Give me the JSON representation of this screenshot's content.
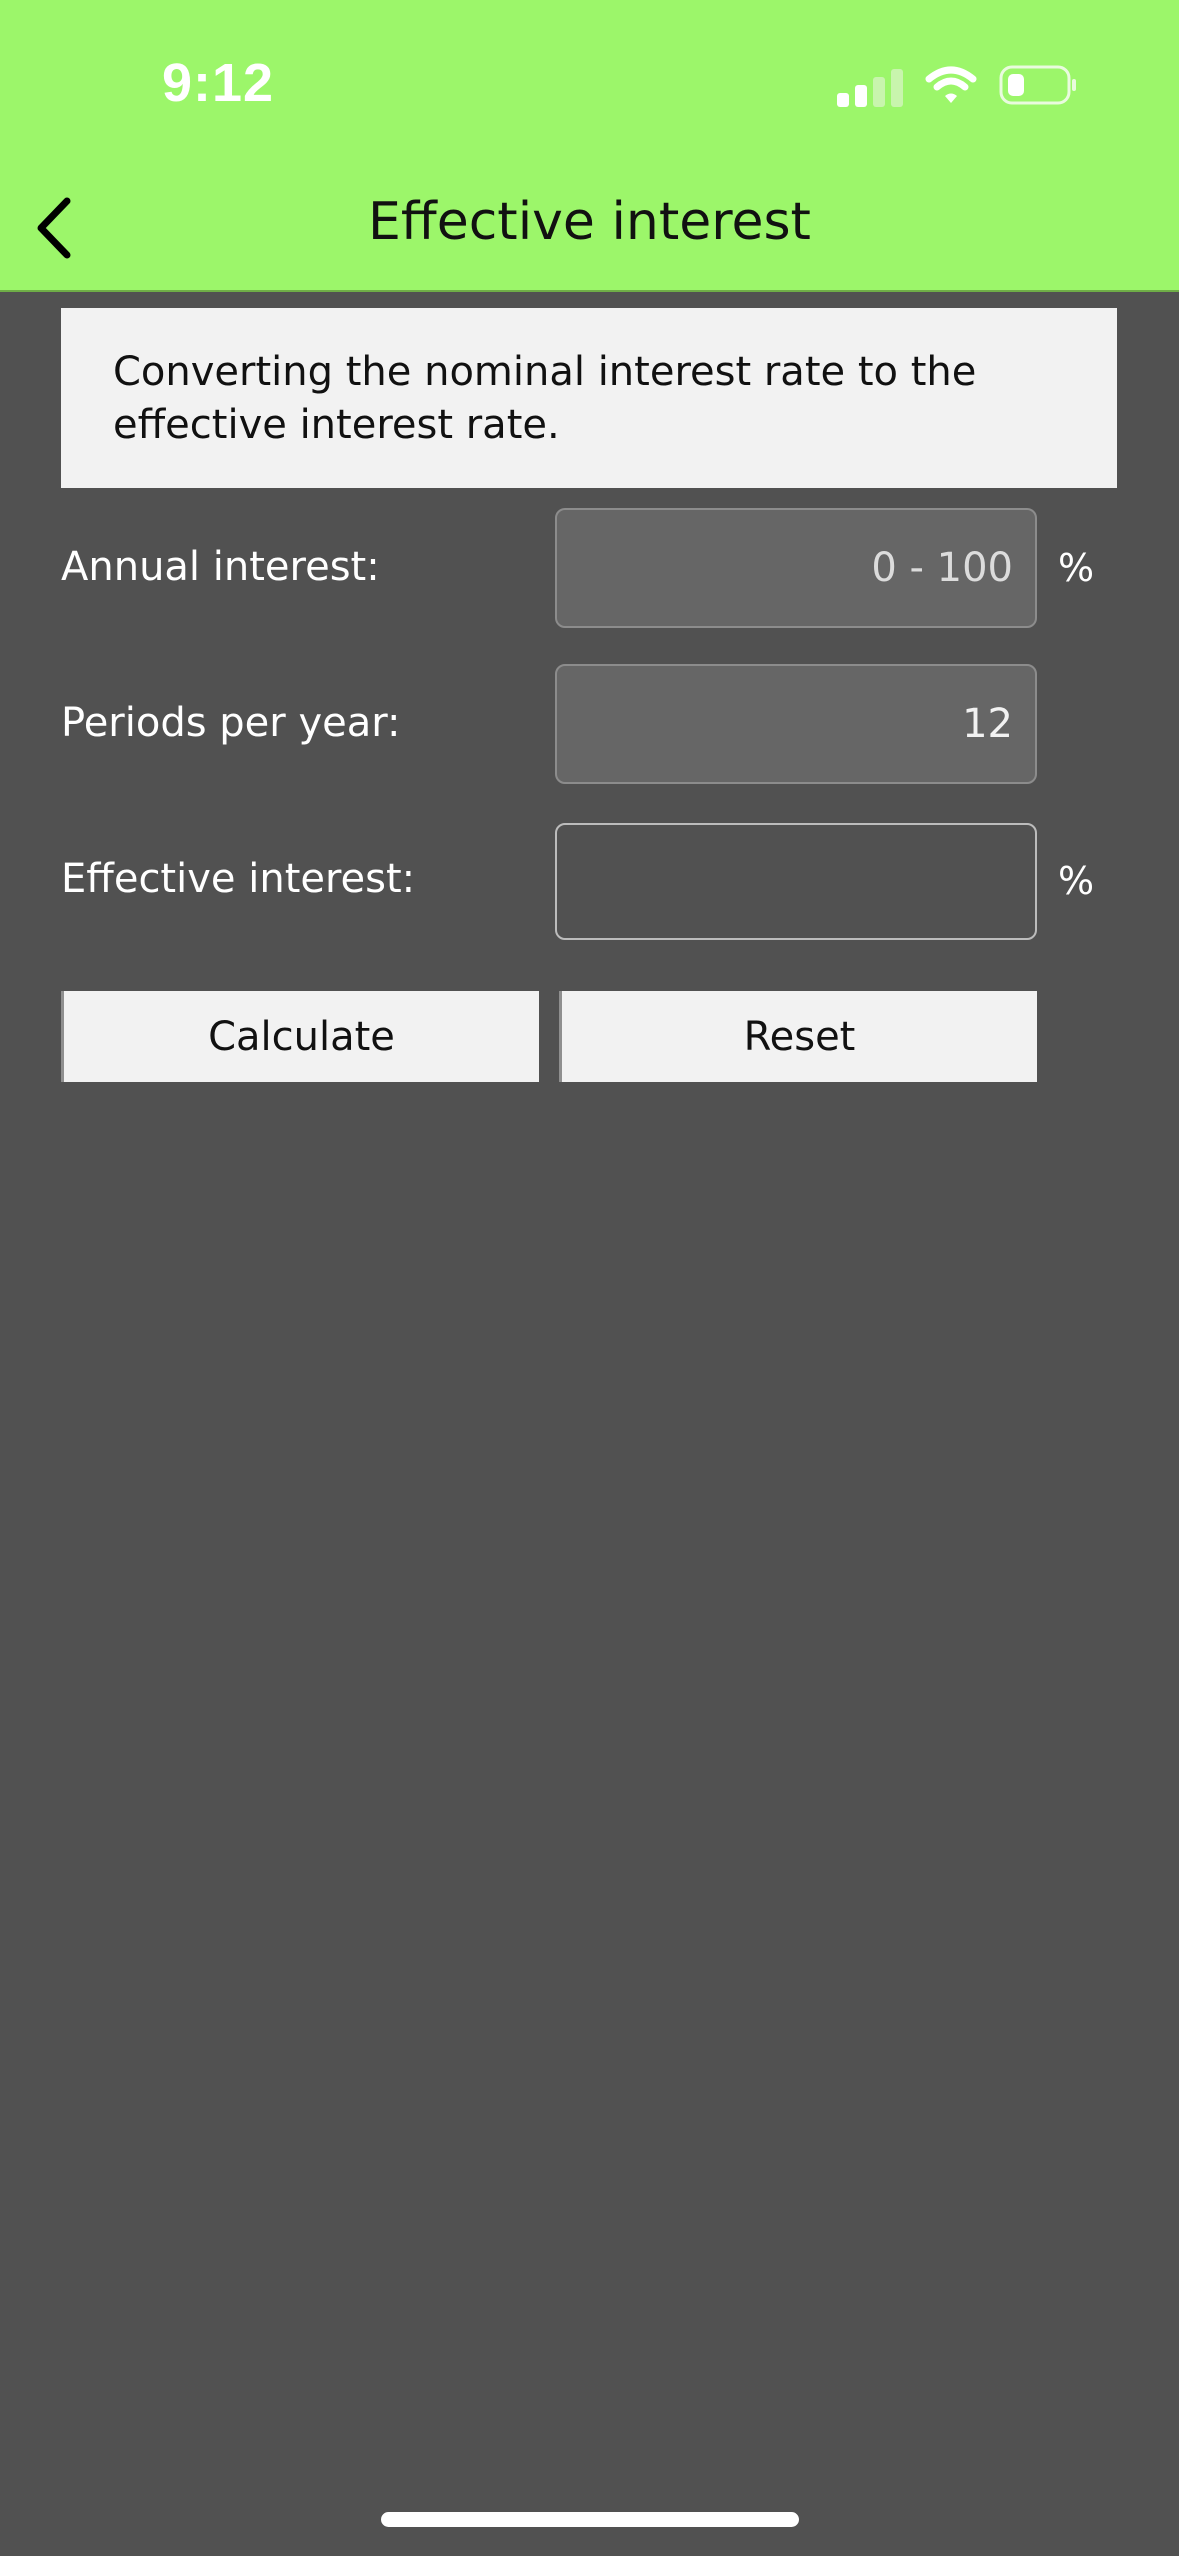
{
  "status_bar": {
    "time": "9:12",
    "signal_icon": "cellular-signal-icon",
    "wifi_icon": "wifi-icon",
    "battery_icon": "battery-icon"
  },
  "header": {
    "title": "Effective interest",
    "back_icon": "chevron-left-icon",
    "background_color": "#9cf66a"
  },
  "description": "Converting the nominal interest rate to the effective interest rate.",
  "form": {
    "annual_interest": {
      "label": "Annual interest:",
      "placeholder": "0 - 100",
      "value": "",
      "unit": "%"
    },
    "periods_per_year": {
      "label": "Periods per year:",
      "value": "12"
    },
    "effective_interest": {
      "label": "Effective interest:",
      "value": "",
      "unit": "%"
    }
  },
  "buttons": {
    "calculate": "Calculate",
    "reset": "Reset"
  }
}
